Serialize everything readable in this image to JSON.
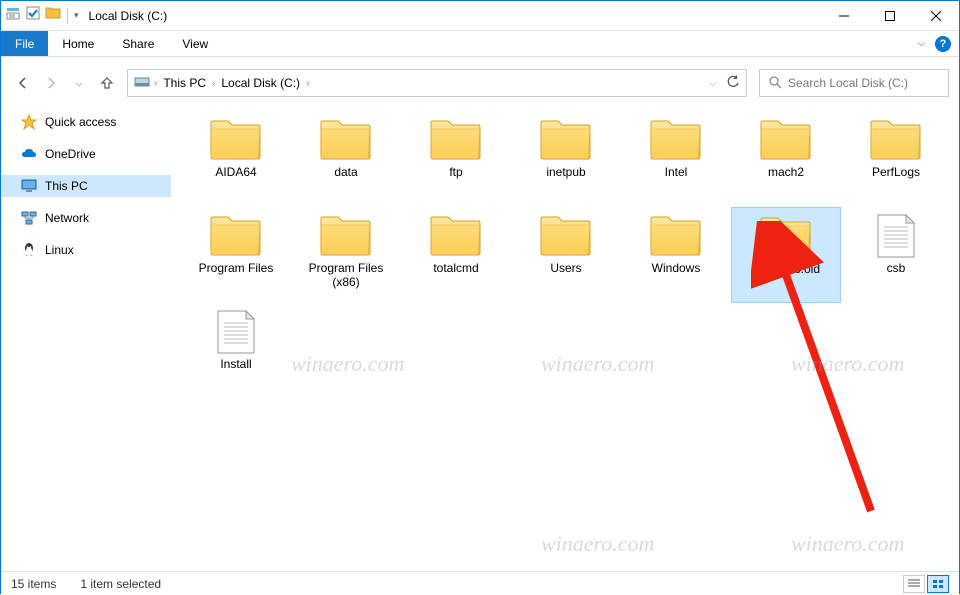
{
  "titlebar": {
    "title": "Local Disk (C:)"
  },
  "ribbon": {
    "file": "File",
    "tabs": [
      "Home",
      "Share",
      "View"
    ]
  },
  "address": {
    "crumbs": [
      "This PC",
      "Local Disk (C:)"
    ]
  },
  "search": {
    "placeholder": "Search Local Disk (C:)"
  },
  "sidebar": {
    "items": [
      {
        "label": "Quick access",
        "icon": "star"
      },
      {
        "label": "OneDrive",
        "icon": "onedrive"
      },
      {
        "label": "This PC",
        "icon": "thispc",
        "selected": true
      },
      {
        "label": "Network",
        "icon": "network"
      },
      {
        "label": "Linux",
        "icon": "linux"
      }
    ]
  },
  "items": [
    {
      "name": "AIDA64",
      "type": "folder"
    },
    {
      "name": "data",
      "type": "folder"
    },
    {
      "name": "ftp",
      "type": "folder"
    },
    {
      "name": "inetpub",
      "type": "folder"
    },
    {
      "name": "Intel",
      "type": "folder"
    },
    {
      "name": "mach2",
      "type": "folder"
    },
    {
      "name": "PerfLogs",
      "type": "folder"
    },
    {
      "name": "Program Files",
      "type": "folder"
    },
    {
      "name": "Program Files (x86)",
      "type": "folder"
    },
    {
      "name": "totalcmd",
      "type": "folder"
    },
    {
      "name": "Users",
      "type": "folder"
    },
    {
      "name": "Windows",
      "type": "folder"
    },
    {
      "name": "Windows.old",
      "type": "folder",
      "selected": true
    },
    {
      "name": "csb",
      "type": "file"
    },
    {
      "name": "Install",
      "type": "file"
    }
  ],
  "status": {
    "count": "15 items",
    "selected": "1 item selected"
  },
  "watermark": "winaero.com"
}
